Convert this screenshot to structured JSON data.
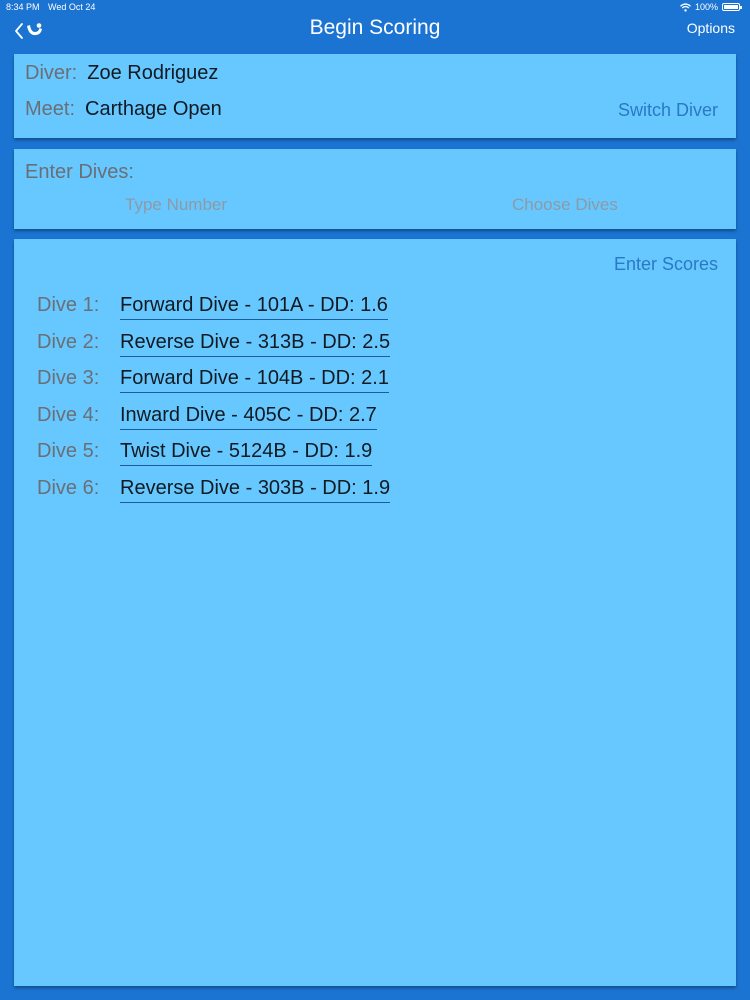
{
  "status_bar": {
    "time": "8:34 PM",
    "date": "Wed Oct 24",
    "battery": "100%"
  },
  "nav": {
    "title": "Begin Scoring",
    "options_label": "Options",
    "back_icon": "chevron-left-icon",
    "logo_icon": "diver-logo-icon"
  },
  "diver_panel": {
    "diver_label": "Diver:",
    "diver_name": "Zoe Rodriguez",
    "meet_label": "Meet:",
    "meet_name": "Carthage Open",
    "switch_label": "Switch Diver"
  },
  "dives_panel": {
    "label": "Enter Dives:",
    "type_number_label": "Type Number",
    "choose_dives_label": "Choose Dives"
  },
  "list_panel": {
    "enter_scores_label": "Enter Scores",
    "dives": [
      {
        "label": "Dive 1:",
        "desc": "Forward Dive - 101A - DD: 1.6"
      },
      {
        "label": "Dive 2:",
        "desc": "Reverse Dive - 313B - DD: 2.5"
      },
      {
        "label": "Dive 3:",
        "desc": "Forward Dive - 104B - DD: 2.1"
      },
      {
        "label": "Dive 4:",
        "desc": "Inward Dive - 405C - DD: 2.7"
      },
      {
        "label": "Dive 5:",
        "desc": "Twist Dive - 5124B - DD: 1.9"
      },
      {
        "label": "Dive 6:",
        "desc": "Reverse Dive - 303B - DD: 1.9"
      }
    ]
  },
  "colors": {
    "background": "#1b74d2",
    "panel": "#66c8ff",
    "link": "#2b78c5"
  }
}
